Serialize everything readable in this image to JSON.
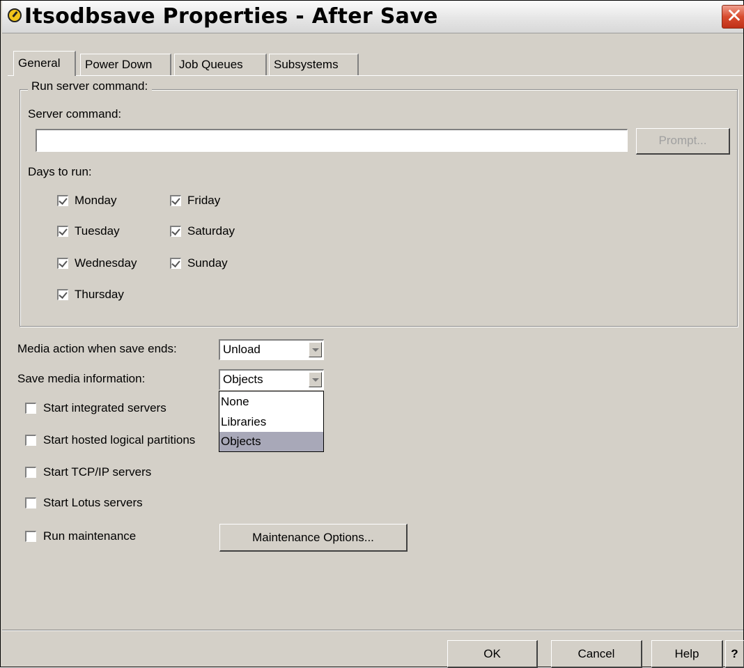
{
  "window": {
    "title": "Itsodbsave Properties - After Save",
    "close_glyph": "✕"
  },
  "tabs": [
    {
      "label": "General",
      "active": true
    },
    {
      "label": "Power Down",
      "active": false
    },
    {
      "label": "Job Queues",
      "active": false
    },
    {
      "label": "Subsystems",
      "active": false
    }
  ],
  "run_command": {
    "group_label": "Run server command:",
    "server_command_label": "Server command:",
    "server_command_value": "",
    "prompt_button": "Prompt...",
    "days_label": "Days to run:",
    "days": [
      {
        "label": "Monday",
        "checked": true
      },
      {
        "label": "Tuesday",
        "checked": true
      },
      {
        "label": "Wednesday",
        "checked": true
      },
      {
        "label": "Thursday",
        "checked": true
      },
      {
        "label": "Friday",
        "checked": true
      },
      {
        "label": "Saturday",
        "checked": true
      },
      {
        "label": "Sunday",
        "checked": true
      }
    ]
  },
  "media": {
    "action_label": "Media action when save ends:",
    "action_value": "Unload",
    "info_label": "Save media information:",
    "info_value": "Objects",
    "info_options": [
      "None",
      "Libraries",
      "Objects"
    ],
    "info_selected": "Objects"
  },
  "options": [
    {
      "label": "Start integrated servers",
      "checked": false
    },
    {
      "label": "Start hosted logical partitions",
      "checked": false
    },
    {
      "label": "Start TCP/IP servers",
      "checked": false
    },
    {
      "label": "Start Lotus servers",
      "checked": false
    },
    {
      "label": "Run maintenance",
      "checked": false
    }
  ],
  "maintenance_button": "Maintenance Options...",
  "footer": {
    "ok": "OK",
    "cancel": "Cancel",
    "help": "Help",
    "whats_this": "?"
  }
}
